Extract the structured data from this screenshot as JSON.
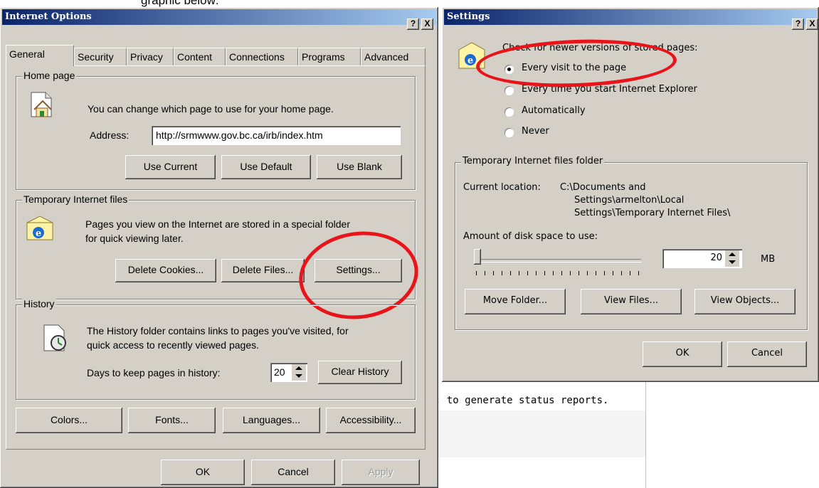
{
  "caption": "graphic below:",
  "left_window": {
    "title": "Internet Options",
    "help_btn": "?",
    "close_btn": "X",
    "tabs": [
      "General",
      "Security",
      "Privacy",
      "Content",
      "Connections",
      "Programs",
      "Advanced"
    ],
    "home_page": {
      "group": "Home page",
      "desc": "You can change which page to use for your home page.",
      "address_label": "Address:",
      "address_value": "http://srmwww.gov.bc.ca/irb/index.htm",
      "use_current": "Use Current",
      "use_default": "Use Default",
      "use_blank": "Use Blank"
    },
    "temp_files": {
      "group": "Temporary Internet files",
      "desc1": "Pages you view on the Internet are stored in a special folder",
      "desc2": "for quick viewing later.",
      "delete_cookies": "Delete Cookies...",
      "delete_files": "Delete Files...",
      "settings": "Settings..."
    },
    "history": {
      "group": "History",
      "desc1": "The History folder contains links to pages you've visited, for",
      "desc2": "quick access to recently viewed pages.",
      "days_label": "Days to keep pages in history:",
      "days_value": "20",
      "clear": "Clear History"
    },
    "buttons": {
      "colors": "Colors...",
      "fonts": "Fonts...",
      "languages": "Languages...",
      "accessibility": "Accessibility...",
      "ok": "OK",
      "cancel": "Cancel",
      "apply": "Apply"
    }
  },
  "right_window": {
    "title": "Settings",
    "help_btn": "?",
    "close_btn": "X",
    "check_label": "Check for newer versions of stored pages:",
    "radios": [
      {
        "label": "Every visit to the page",
        "selected": true
      },
      {
        "label": "Every time you start Internet Explorer",
        "selected": false
      },
      {
        "label": "Automatically",
        "selected": false
      },
      {
        "label": "Never",
        "selected": false
      }
    ],
    "temp_group": "Temporary Internet files folder",
    "current_location_label": "Current location:",
    "current_location_value1": "C:\\Documents and",
    "current_location_value2": "Settings\\armelton\\Local",
    "current_location_value3": "Settings\\Temporary Internet Files\\",
    "disk_label": "Amount of disk space to use:",
    "disk_value": "20",
    "disk_unit": "MB",
    "move_folder": "Move Folder...",
    "view_files": "View Files...",
    "view_objects": "View Objects...",
    "ok": "OK",
    "cancel": "Cancel"
  },
  "background": {
    "status_text": "; to generate status reports."
  },
  "colors": {
    "highlight_ring": "#e8141a",
    "title_start": "#0a246a",
    "title_end": "#a6caf0",
    "face": "#d4d0c8"
  }
}
